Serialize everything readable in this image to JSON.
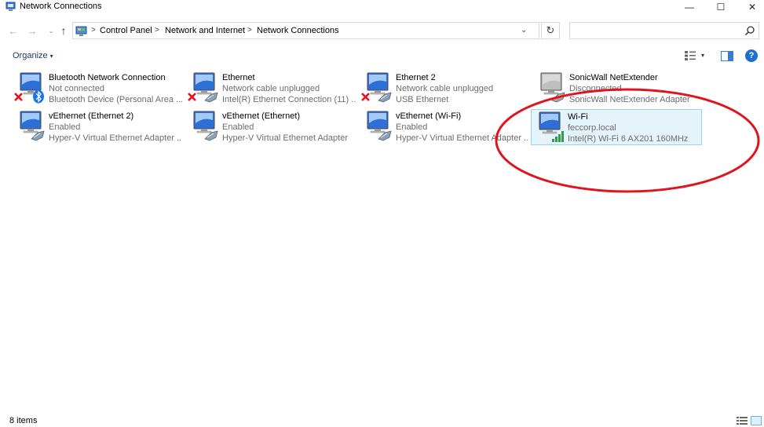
{
  "window": {
    "title": "Network Connections",
    "minimize_glyph": "—",
    "maximize_glyph": "☐",
    "close_glyph": "✕"
  },
  "nav": {
    "back_glyph": "←",
    "forward_glyph": "→",
    "recent_glyph": "⌄",
    "up_glyph": "↑",
    "breadcrumb_sep": ">",
    "breadcrumb": [
      "Control Panel",
      "Network and Internet",
      "Network Connections"
    ],
    "refresh_glyph": "↻",
    "search_placeholder": ""
  },
  "toolbar": {
    "organize_label": "Organize",
    "caret": "▾",
    "help_glyph": "?"
  },
  "items": [
    {
      "name": "Bluetooth Network Connection",
      "status": "Not connected",
      "device": "Bluetooth Device (Personal Area ...",
      "state": "disconnected",
      "badge": "bluetooth"
    },
    {
      "name": "Ethernet",
      "status": "Network cable unplugged",
      "device": "Intel(R) Ethernet Connection (11) ...",
      "state": "disconnected",
      "badge": "cable"
    },
    {
      "name": "Ethernet 2",
      "status": "Network cable unplugged",
      "device": "USB Ethernet",
      "state": "disconnected",
      "badge": "cable"
    },
    {
      "name": "SonicWall NetExtender",
      "status": "Disconnected",
      "device": "SonicWall NetExtender Adapter",
      "state": "disabled",
      "badge": "cable"
    },
    {
      "name": "vEthernet (Ethernet 2)",
      "status": "Enabled",
      "device": "Hyper-V Virtual Ethernet Adapter ...",
      "state": "enabled",
      "badge": "cable"
    },
    {
      "name": "vEthernet (Ethernet)",
      "status": "Enabled",
      "device": "Hyper-V Virtual Ethernet Adapter",
      "state": "enabled",
      "badge": "cable"
    },
    {
      "name": "vEthernet (Wi-Fi)",
      "status": "Enabled",
      "device": "Hyper-V Virtual Ethernet Adapter ...",
      "state": "enabled",
      "badge": "cable"
    },
    {
      "name": "Wi-Fi",
      "status": "feccorp.local",
      "device": "Intel(R) Wi-Fi 6 AX201 160MHz",
      "state": "connected",
      "badge": "signal",
      "selected": true
    }
  ],
  "status_bar": {
    "item_count": "8 items"
  },
  "colors": {
    "annotation": "#e0141e",
    "selection_bg": "#e5f3fb",
    "selection_border": "#99d1f0",
    "signal": "#2ea043",
    "error_x": "#e81123",
    "link_text": "#1e3c64"
  }
}
